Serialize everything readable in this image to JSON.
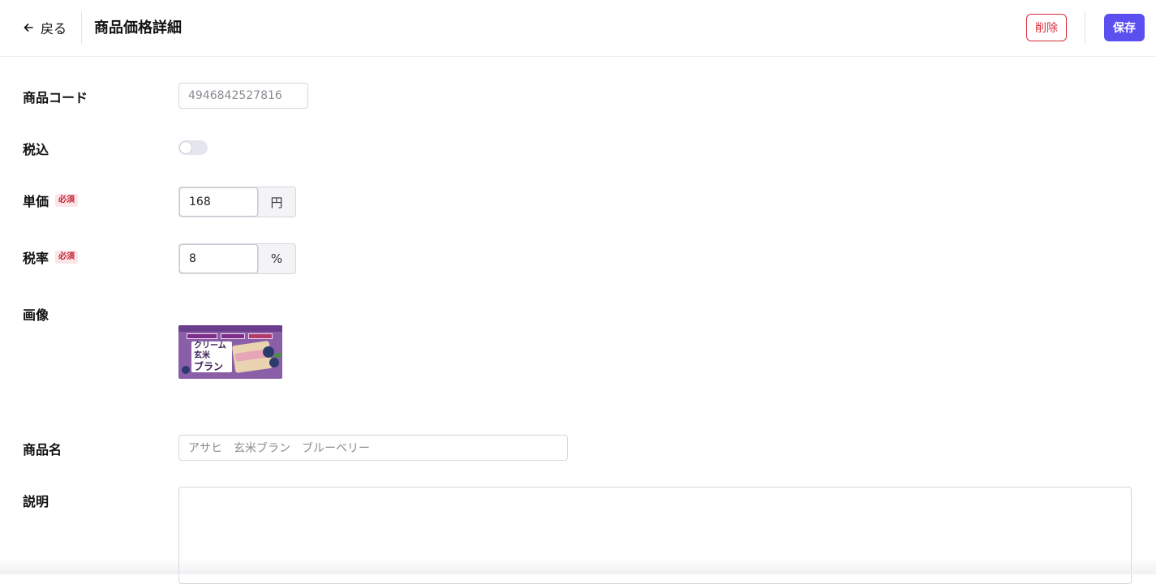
{
  "header": {
    "back_label": "戻る",
    "title": "商品価格詳細",
    "delete_label": "削除",
    "save_label": "保存"
  },
  "form": {
    "product_code": {
      "label": "商品コード",
      "value": "4946842527816"
    },
    "tax_included": {
      "label": "税込",
      "checked": false
    },
    "unit_price": {
      "label": "単価",
      "required_label": "必須",
      "value": "168",
      "unit": "円"
    },
    "tax_rate": {
      "label": "税率",
      "required_label": "必須",
      "value": "8",
      "unit": "%"
    },
    "image": {
      "label": "画像",
      "product_text_line1": "クリーム玄米",
      "product_text_line2": "ブラン"
    },
    "product_name": {
      "label": "商品名",
      "value": "アサヒ　玄米ブラン　ブルーベリー"
    },
    "description": {
      "label": "説明",
      "value": ""
    }
  },
  "colors": {
    "primary": "#5b4ff0",
    "danger": "#d92d3b",
    "required_bg": "#fde4e7",
    "required_text": "#c0283a"
  },
  "icons": {
    "back": "arrow-left-icon"
  }
}
